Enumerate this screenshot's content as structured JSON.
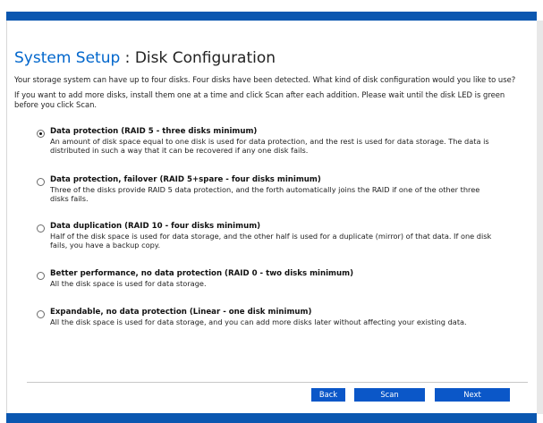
{
  "page": {
    "title_prefix": "System Setup",
    "title_sep": " : ",
    "title_suffix": "Disk Configuration",
    "intro1": "Your storage system can have up to four disks. Four disks have been detected. What kind of disk configuration would you like to use?",
    "intro2": "If you want to add more disks, install them one at a time and click Scan after each addition. Please wait until the disk LED is green before you click Scan."
  },
  "options": [
    {
      "title": "Data protection (RAID 5 - three disks minimum)",
      "desc": "An amount of disk space equal to one disk is used for data protection, and the rest is used for data storage. The data is distributed in such a way that it can be recovered if any one disk fails.",
      "selected": true
    },
    {
      "title": "Data protection, failover (RAID 5+spare - four disks minimum)",
      "desc": "Three of the disks provide RAID 5 data protection, and the forth automatically joins the RAID if one of the other three disks fails.",
      "selected": false
    },
    {
      "title": "Data duplication (RAID 10 - four disks minimum)",
      "desc": "Half of the disk space is used for data storage, and the other half is used for a duplicate (mirror) of that data. If one disk fails, you have a backup copy.",
      "selected": false
    },
    {
      "title": "Better performance, no data protection (RAID 0 - two disks minimum)",
      "desc": "All the disk space is used for data storage.",
      "selected": false
    },
    {
      "title": "Expandable, no data protection (Linear - one disk minimum)",
      "desc": "All the disk space is used for data storage, and you can add more disks later without affecting your existing data.",
      "selected": false
    }
  ],
  "buttons": {
    "back": "Back",
    "scan": "Scan",
    "next": "Next"
  },
  "colors": {
    "bar": "#0b57b0",
    "accent": "#0066cc",
    "button": "#0b57c8"
  }
}
